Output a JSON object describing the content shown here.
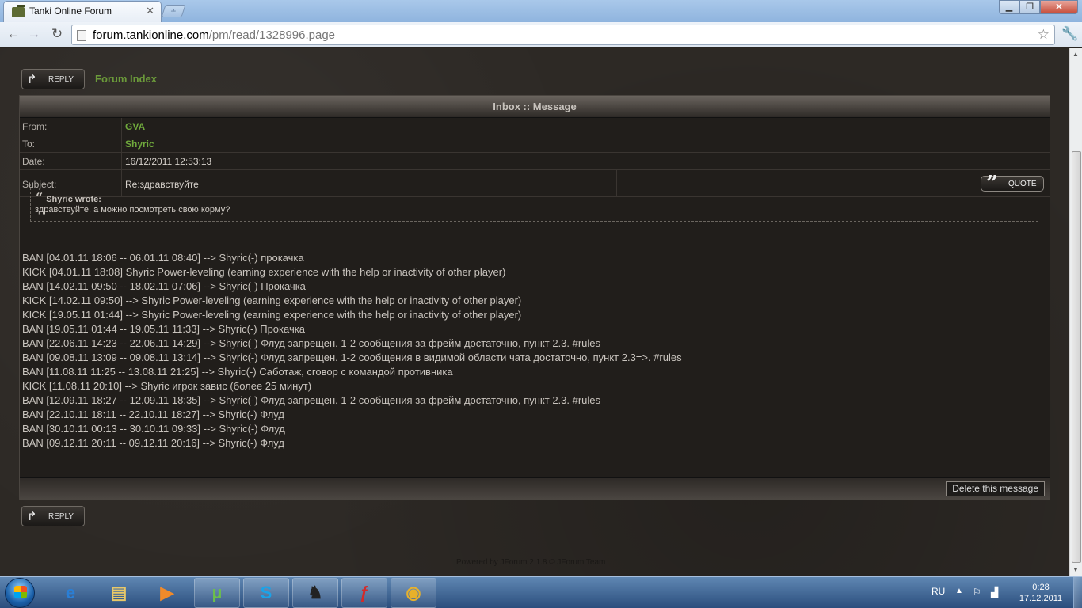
{
  "browser": {
    "tab_title": "Tanki Online Forum",
    "tab_close": "✕",
    "new_tab": "+",
    "url_host": "forum.tankionline.com",
    "url_path": "/pm/read/1328996.page"
  },
  "window_controls": {
    "minimize": "▁",
    "maximize": "❐",
    "close": "✕"
  },
  "nav": {
    "back": "←",
    "forward": "→",
    "reload": "↻",
    "bookmark": "☆",
    "wrench": "🔧"
  },
  "page": {
    "reply_label": "REPLY",
    "forum_index": "Forum Index",
    "panel_title": "Inbox :: Message",
    "fields": {
      "from_label": "From:",
      "from_value": "GVA",
      "to_label": "To:",
      "to_value": "Shyric",
      "date_label": "Date:",
      "date_value": "16/12/2011 12:53:13",
      "subject_label": "Subject:",
      "subject_value": "Re:здравствуйте"
    },
    "quote_label": "QUOTE",
    "quote": {
      "author": "Shyric wrote:",
      "text": "здравствуйте. а можно посмотреть свою корму?"
    },
    "body_lines": [
      "BAN [04.01.11 18:06 -- 06.01.11 08:40] --> Shyric(-) прокачка",
      "KICK [04.01.11 18:08] Shyric Power-leveling (earning experience with the help or inactivity of other player)",
      "BAN [14.02.11 09:50 -- 18.02.11 07:06] --> Shyric(-) Прокачка",
      "KICK [14.02.11 09:50] --> Shyric Power-leveling (earning experience with the help or inactivity of other player)",
      "KICK [19.05.11 01:44] --> Shyric Power-leveling (earning experience with the help or inactivity of other player)",
      "BAN [19.05.11 01:44 -- 19.05.11 11:33] --> Shyric(-) Прокачка",
      "BAN [22.06.11 14:23 -- 22.06.11 14:29] --> Shyric(-) Флуд запрещен. 1-2 сообщения за фрейм достаточно, пункт 2.3. #rules",
      "BAN [09.08.11 13:09 -- 09.08.11 13:14] --> Shyric(-) Флуд запрещен. 1-2 сообщения в видимой области чата достаточно, пункт 2.3=>. #rules",
      "BAN [11.08.11 11:25 -- 13.08.11 21:25] --> Shyric(-) Саботаж, сговор с командой противника",
      "KICK [11.08.11 20:10] --> Shyric игрок завис (более 25 минут)",
      "BAN [12.09.11 18:27 -- 12.09.11 18:35] --> Shyric(-) Флуд запрещен. 1-2 сообщения за фрейм достаточно, пункт 2.3. #rules",
      "BAN [22.10.11 18:11 -- 22.10.11 18:27] --> Shyric(-) Флуд",
      "BAN [30.10.11 00:13 -- 30.10.11 09:33] --> Shyric(-) Флуд",
      "BAN [09.12.11 20:11 -- 09.12.11 20:16] --> Shyric(-) Флуд"
    ],
    "delete_label": "Delete this message",
    "footer_credit": "Powered by JForum 2.1.8 © JForum Team"
  },
  "taskbar": {
    "items": [
      {
        "name": "internet-explorer",
        "glyph": "e",
        "color": "#2a7fd6"
      },
      {
        "name": "file-explorer",
        "glyph": "▤",
        "color": "#e8c868"
      },
      {
        "name": "media-player",
        "glyph": "▶",
        "color": "#f08a2a"
      },
      {
        "name": "utorrent",
        "glyph": "µ",
        "color": "#6cc04a"
      },
      {
        "name": "skype",
        "glyph": "S",
        "color": "#1aa3e8"
      },
      {
        "name": "tanki-online",
        "glyph": "♞",
        "color": "#222222"
      },
      {
        "name": "flash-player",
        "glyph": "ƒ",
        "color": "#d42a2a"
      },
      {
        "name": "chrome",
        "glyph": "◉",
        "color": "#e8b12a"
      }
    ],
    "lang": "RU",
    "time": "0:28",
    "date": "17.12.2011"
  }
}
